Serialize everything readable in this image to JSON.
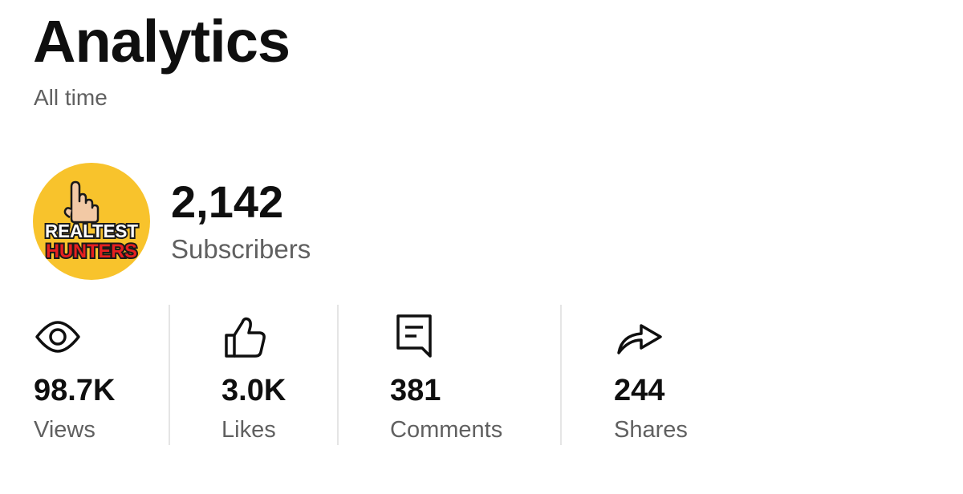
{
  "header": {
    "title": "Analytics",
    "period": "All time"
  },
  "channel": {
    "avatar_text_top": "REALTEST",
    "avatar_text_bottom": "HUNTERS",
    "subscribers_count": "2,142",
    "subscribers_label": "Subscribers",
    "avatar_bg_color": "#f8c32c"
  },
  "stats": [
    {
      "icon": "eye-icon",
      "value": "98.7K",
      "label": "Views"
    },
    {
      "icon": "thumbs-up-icon",
      "value": "3.0K",
      "label": "Likes"
    },
    {
      "icon": "comment-icon",
      "value": "381",
      "label": "Comments"
    },
    {
      "icon": "share-icon",
      "value": "244",
      "label": "Shares"
    }
  ]
}
